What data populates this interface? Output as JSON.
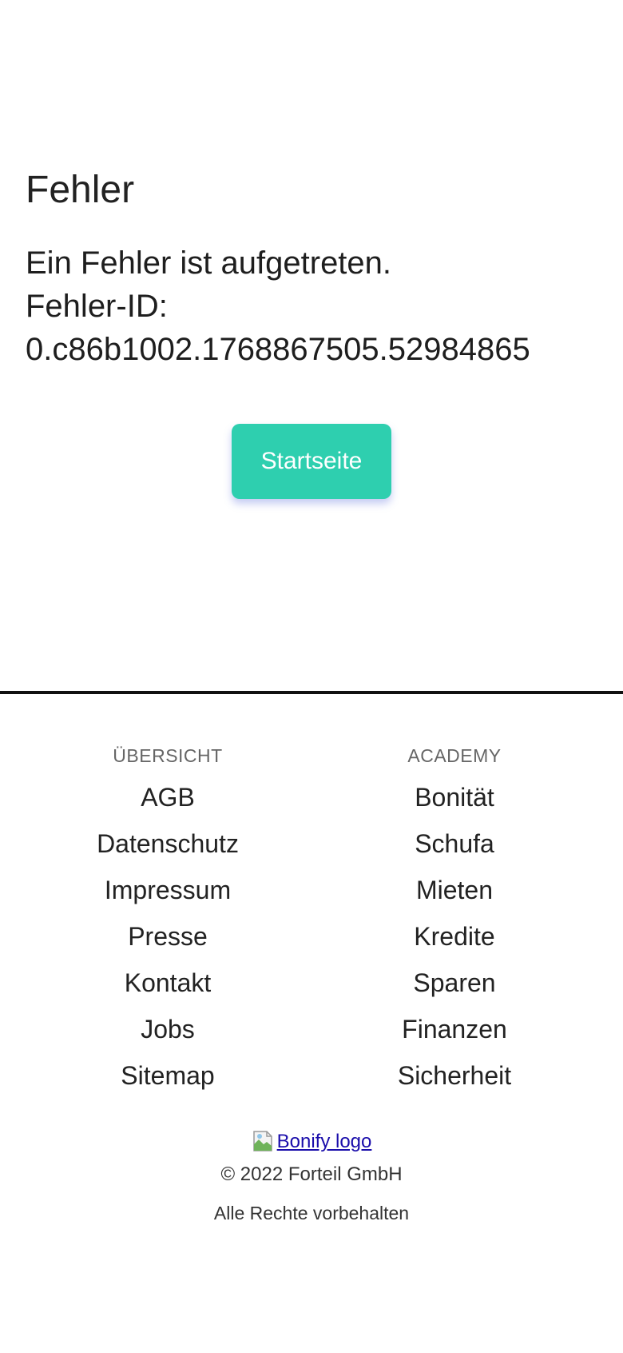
{
  "error": {
    "title": "Fehler",
    "message": "Ein Fehler ist aufgetreten.",
    "id_label": "Fehler-ID:",
    "id_value": "0.c86b1002.1768867505.52984865",
    "button_label": "Startseite"
  },
  "footer": {
    "overview": {
      "heading": "ÜBERSICHT",
      "links": [
        "AGB",
        "Datenschutz",
        "Impressum",
        "Presse",
        "Kontakt",
        "Jobs",
        "Sitemap"
      ]
    },
    "academy": {
      "heading": "ACADEMY",
      "links": [
        "Bonität",
        "Schufa",
        "Mieten",
        "Kredite",
        "Sparen",
        "Finanzen",
        "Sicherheit"
      ]
    },
    "logo_alt": "Bonify logo",
    "copyright": "© 2022 Forteil GmbH",
    "rights": "Alle Rechte vorbehalten"
  },
  "colors": {
    "accent": "#2ecfaf",
    "link": "#1a0dab"
  }
}
